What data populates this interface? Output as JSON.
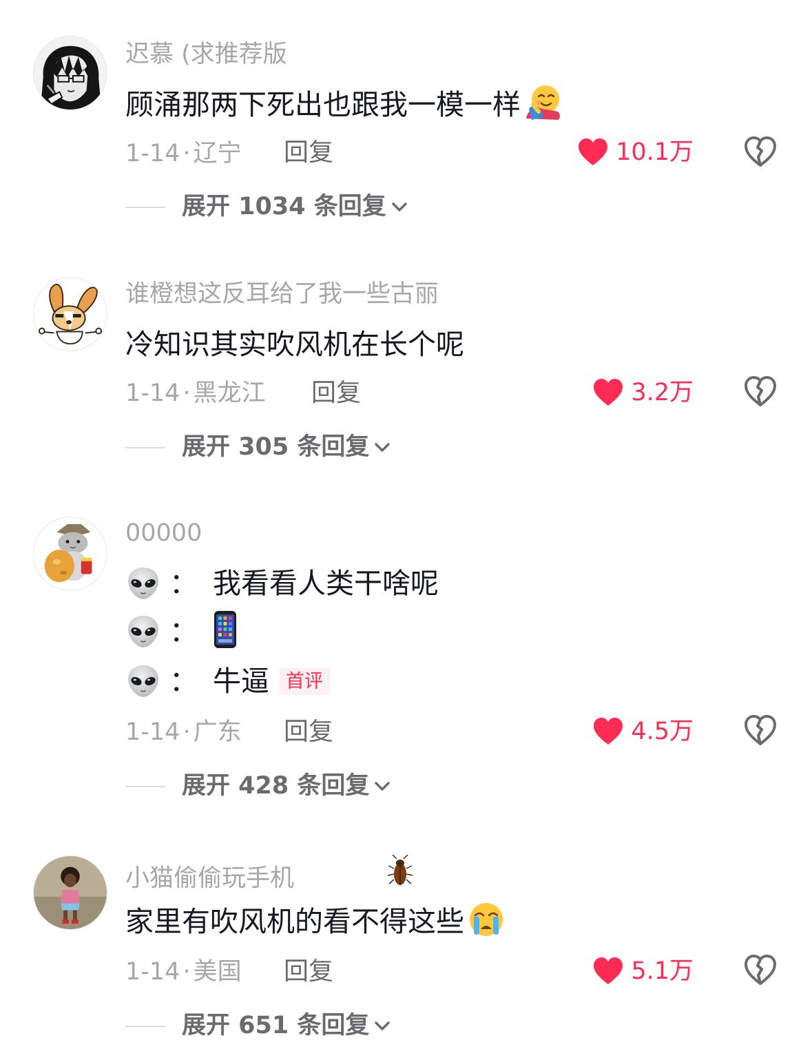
{
  "comments": [
    {
      "username": "迟慕 (求推荐版",
      "text": "顾涌那两下死出也跟我一模一样",
      "emoji": "hugging-face",
      "date": "1-14",
      "location": "辽宁",
      "reply_label": "回复",
      "likes": "10.1万",
      "expand_label": "展开 1034 条回复"
    },
    {
      "username": "谁橙想这反耳给了我一些古丽",
      "text": "冷知识其实吹风机在长个呢",
      "date": "1-14",
      "location": "黑龙江",
      "reply_label": "回复",
      "likes": "3.2万",
      "expand_label": "展开 305 条回复"
    },
    {
      "username": "00000",
      "lines": [
        {
          "icon": "alien",
          "colon": "：",
          "text": "我看看人类干啥呢"
        },
        {
          "icon": "alien",
          "colon": "：",
          "emoji": "mobile-phone"
        },
        {
          "icon": "alien",
          "colon": "：",
          "text": "牛逼",
          "badge": "首评"
        }
      ],
      "date": "1-14",
      "location": "广东",
      "reply_label": "回复",
      "likes": "4.5万",
      "expand_label": "展开 428 条回复"
    },
    {
      "username": "小猫偷偷玩手机",
      "username_emoji": "cockroach",
      "text": "家里有吹风机的看不得这些",
      "emoji": "crying-face",
      "date": "1-14",
      "location": "美国",
      "reply_label": "回复",
      "likes": "5.1万",
      "expand_label": "展开 651 条回复"
    }
  ],
  "meta_separator": "·",
  "colors": {
    "like_red": "#fe2c55",
    "secondary_text": "#a7a7ab",
    "primary_text": "#161823",
    "action_text": "#6a6a70"
  }
}
